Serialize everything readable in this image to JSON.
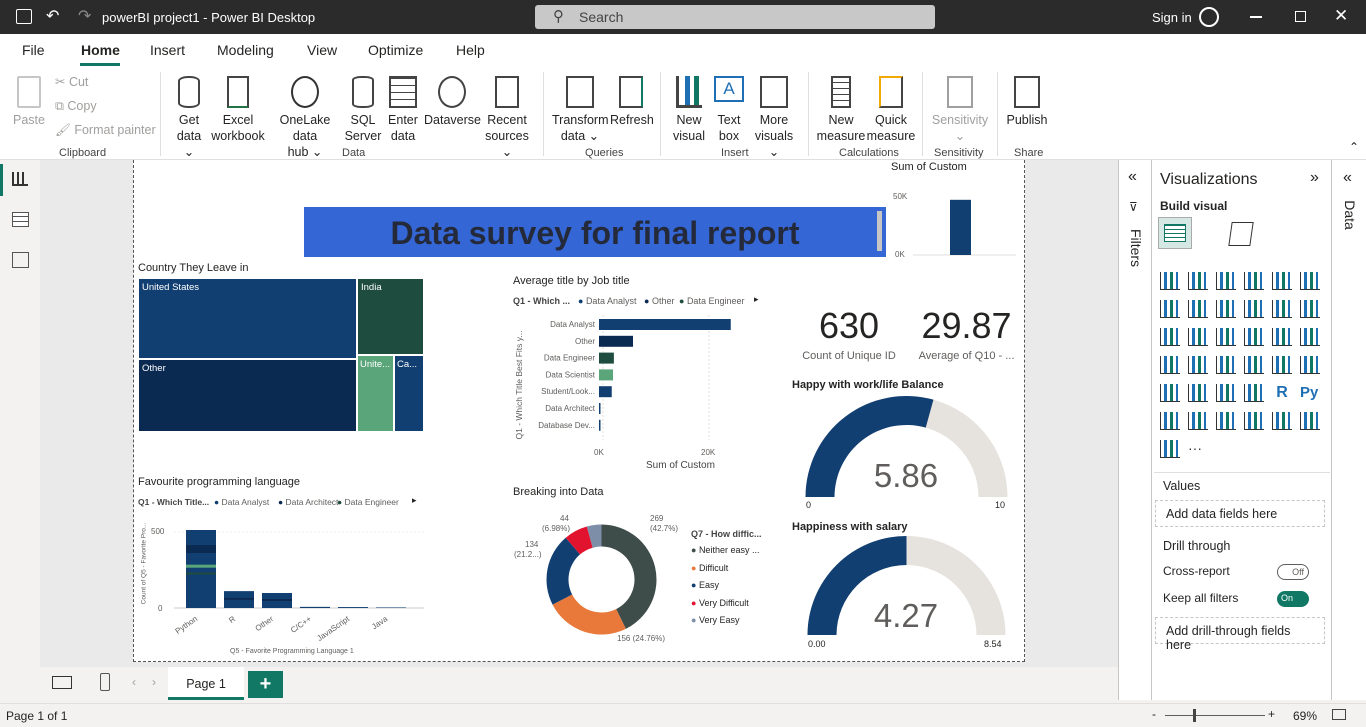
{
  "window": {
    "title": "powerBI project1 - Power BI Desktop",
    "search_placeholder": "Search",
    "sign_in": "Sign in"
  },
  "menu": [
    "File",
    "Home",
    "Insert",
    "Modeling",
    "View",
    "Optimize",
    "Help"
  ],
  "ribbon": {
    "clipboard": {
      "paste": "Paste",
      "cut": "Cut",
      "copy": "Copy",
      "format_painter": "Format painter",
      "group": "Clipboard"
    },
    "data": {
      "get_data": "Get",
      "get_data2": "data",
      "excel": "Excel",
      "excel2": "workbook",
      "onelake": "OneLake data",
      "onelake2": "hub",
      "sql": "SQL",
      "sql2": "Server",
      "enter": "Enter",
      "enter2": "data",
      "dataverse": "Dataverse",
      "recent": "Recent",
      "recent2": "sources",
      "group": "Data"
    },
    "queries": {
      "transform": "Transform",
      "transform2": "data",
      "refresh": "Refresh",
      "group": "Queries"
    },
    "insert": {
      "new_visual": "New",
      "new_visual2": "visual",
      "text_box": "Text",
      "text_box2": "box",
      "more": "More",
      "more2": "visuals",
      "group": "Insert"
    },
    "calc": {
      "new_measure": "New",
      "new_measure2": "measure",
      "quick": "Quick",
      "quick2": "measure",
      "group": "Calculations"
    },
    "sensitivity": {
      "label": "Sensitivity",
      "group": "Sensitivity"
    },
    "share": {
      "publish": "Publish",
      "group": "Share"
    }
  },
  "report": {
    "banner_title": "Data survey for final report",
    "sum_custom": {
      "title": "Sum of Custom",
      "tick_top": "50K",
      "tick_bottom": "0K"
    },
    "treemap": {
      "title": "Country They Leave in",
      "cells": [
        "United States",
        "India",
        "Other",
        "Unite...",
        "Ca..."
      ]
    },
    "bar_job": {
      "title": "Average title by Job title",
      "legend_prefix": "Q1 - Which ...",
      "legend": [
        "Data Analyst",
        "Other",
        "Data Engineer"
      ],
      "ylabel": "Q1 - Which Title Best Fits y...",
      "xlabel": "Sum of Custom",
      "xticks": [
        "0K",
        "20K"
      ]
    },
    "card1": {
      "value": "630",
      "label": "Count of Unique ID"
    },
    "card2": {
      "value": "29.87",
      "label": "Average of Q10 - ..."
    },
    "gauge1": {
      "title": "Happy with work/life Balance",
      "value": "5.86",
      "min": "0",
      "max": "10"
    },
    "gauge2": {
      "title": "Happiness with salary",
      "value": "4.27",
      "min": "0.00",
      "max": "8.54"
    },
    "lang": {
      "title": "Favourite programming language",
      "legend_prefix": "Q1 - Which Title...",
      "legend": [
        "Data Analyst",
        "Data Architect",
        "Data Engineer"
      ],
      "ylabel": "Count of Q5 - Favorite Pro...",
      "xlabel": "Q5 - Favorite Programming Language 1",
      "yticks": [
        "500",
        "0"
      ]
    },
    "donut": {
      "title": "Breaking into Data",
      "legend_title": "Q7 - How diffic...",
      "legend": [
        "Neither easy ...",
        "Difficult",
        "Easy",
        "Very Difficult",
        "Very Easy"
      ],
      "labels": {
        "a1": "269",
        "a2": "(42.7%)",
        "b": "156 (24.76%)",
        "c1": "134",
        "c2": "(21.2...)",
        "d1": "44",
        "d2": "(6.98%)"
      }
    }
  },
  "chart_data": [
    {
      "type": "bar",
      "title": "Average title by Job title",
      "categories": [
        "Data Analyst",
        "Other",
        "Data Engineer",
        "Data Scientist",
        "Student/Look...",
        "Data Architect",
        "Database Dev..."
      ],
      "values": [
        31000,
        8000,
        3500,
        3300,
        3000,
        300,
        150
      ],
      "xlabel": "Sum of Custom",
      "xlim": [
        0,
        40000
      ]
    },
    {
      "type": "bar",
      "title": "Favourite programming language",
      "categories": [
        "Python",
        "R",
        "Other",
        "C/C++",
        "JavaScript",
        "Java"
      ],
      "values": [
        420,
        90,
        80,
        6,
        5,
        3
      ],
      "ylim": [
        0,
        600
      ]
    },
    {
      "type": "pie",
      "title": "Breaking into Data",
      "categories": [
        "Neither easy ...",
        "Difficult",
        "Easy",
        "Very Difficult",
        "Very Easy"
      ],
      "values": [
        269,
        156,
        134,
        44,
        27
      ]
    },
    {
      "type": "bar",
      "title": "Sum of Custom",
      "categories": [
        ""
      ],
      "values": [
        46000
      ],
      "ylim": [
        0,
        50000
      ]
    }
  ],
  "visualizations": {
    "title": "Visualizations",
    "build_visual": "Build visual",
    "values": "Values",
    "add_data": "Add data fields here",
    "drill": "Drill through",
    "cross_report": "Cross-report",
    "cross_state": "Off",
    "keep_filters": "Keep all filters",
    "keep_state": "On",
    "add_drill": "Add drill-through fields here"
  },
  "filters_label": "Filters",
  "data_label": "Data",
  "tabs": {
    "page1": "Page 1",
    "add": "+"
  },
  "status": {
    "page": "Page 1 of 1",
    "zoom": "69%"
  },
  "colors": {
    "navy": "#123f72",
    "dark": "#0b2a52",
    "teal": "#1e4d3f",
    "green": "#5aa67a",
    "orange": "#e8793a",
    "red": "#e2132f",
    "slate": "#3f4d4a",
    "banner": "#3466d6"
  }
}
